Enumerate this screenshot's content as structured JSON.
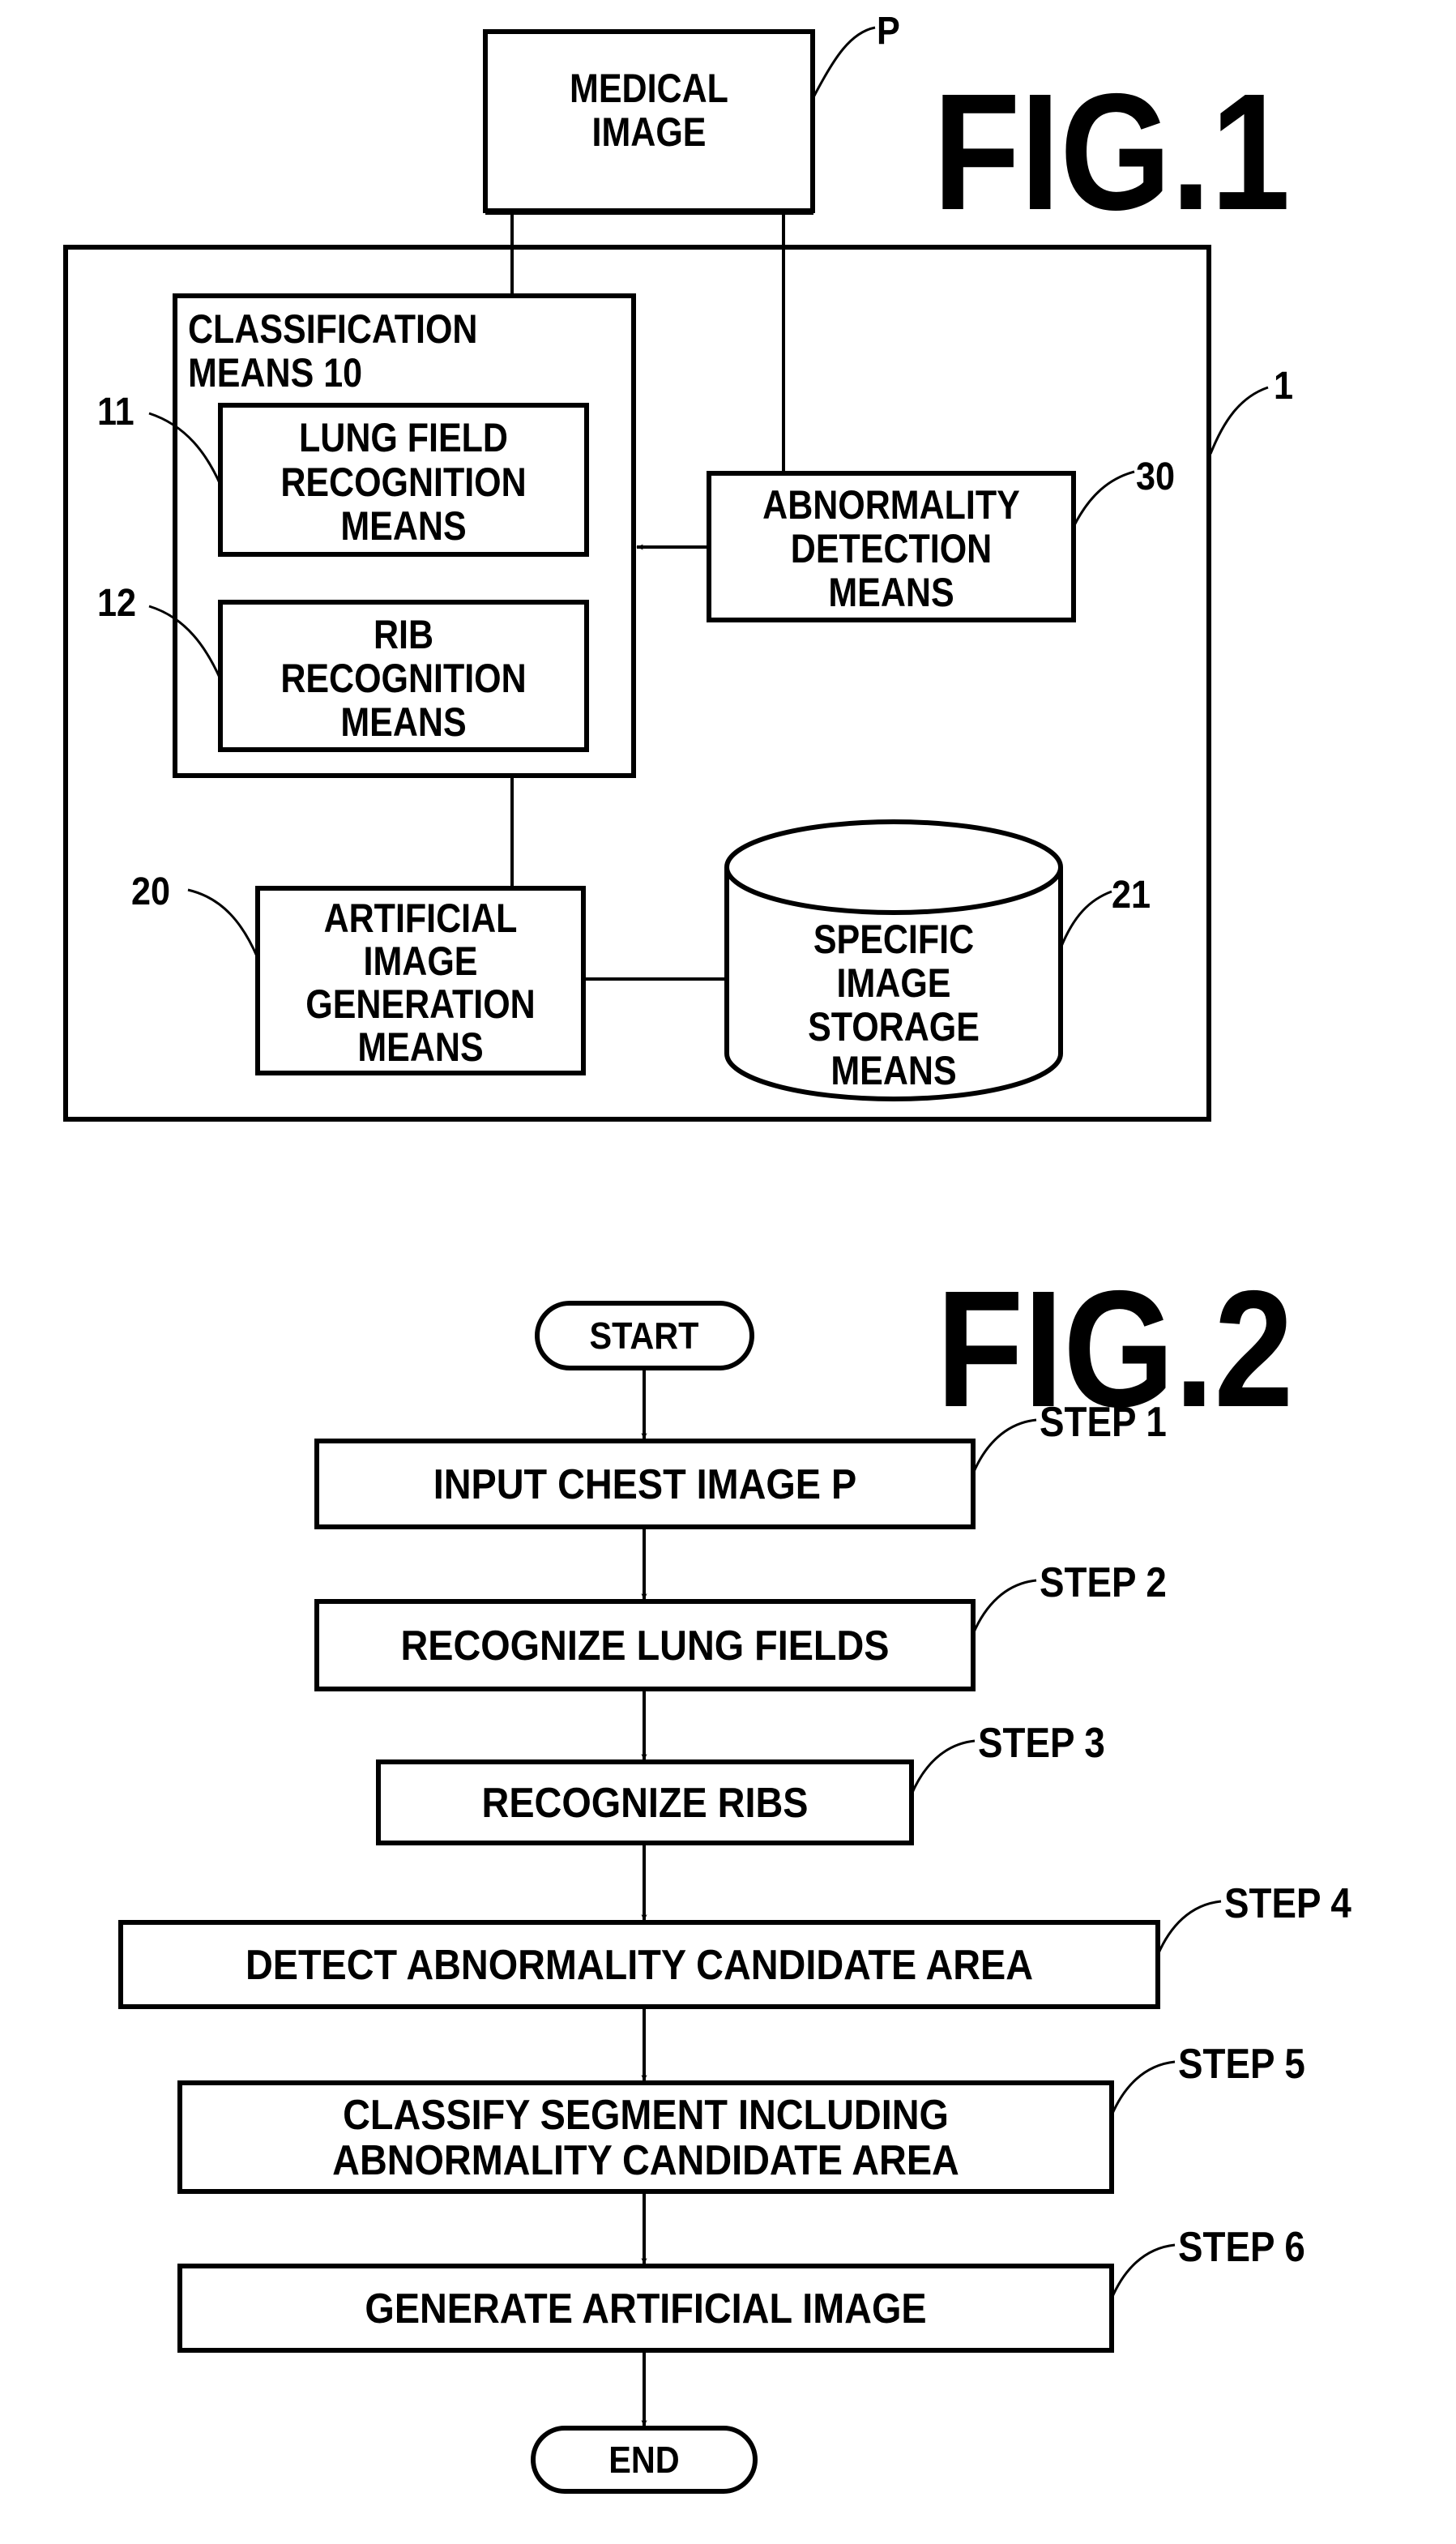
{
  "fig1": {
    "title": "FIG.1",
    "medical_image": {
      "lines": [
        "MEDICAL",
        "IMAGE"
      ],
      "ref": "P"
    },
    "apparatus": {
      "ref": "1"
    },
    "classification": {
      "lines": [
        "CLASSIFICATION",
        "MEANS 10"
      ]
    },
    "lung_field": {
      "lines": [
        "LUNG FIELD",
        "RECOGNITION",
        "MEANS"
      ],
      "ref": "11"
    },
    "rib": {
      "lines": [
        "RIB",
        "RECOGNITION",
        "MEANS"
      ],
      "ref": "12"
    },
    "abnormality": {
      "lines": [
        "ABNORMALITY",
        "DETECTION",
        "MEANS"
      ],
      "ref": "30"
    },
    "artificial": {
      "lines": [
        "ARTIFICIAL",
        "IMAGE",
        "GENERATION",
        "MEANS"
      ],
      "ref": "20"
    },
    "storage": {
      "lines": [
        "SPECIFIC",
        "IMAGE",
        "STORAGE",
        "MEANS"
      ],
      "ref": "21"
    }
  },
  "fig2": {
    "title": "FIG.2",
    "start": "START",
    "end": "END",
    "steps": [
      {
        "label": "STEP 1",
        "lines": [
          "INPUT CHEST IMAGE P"
        ]
      },
      {
        "label": "STEP 2",
        "lines": [
          "RECOGNIZE LUNG FIELDS"
        ]
      },
      {
        "label": "STEP 3",
        "lines": [
          "RECOGNIZE RIBS"
        ]
      },
      {
        "label": "STEP 4",
        "lines": [
          "DETECT ABNORMALITY CANDIDATE AREA"
        ]
      },
      {
        "label": "STEP 5",
        "lines": [
          "CLASSIFY SEGMENT INCLUDING",
          "ABNORMALITY CANDIDATE AREA"
        ]
      },
      {
        "label": "STEP 6",
        "lines": [
          "GENERATE ARTIFICIAL IMAGE"
        ]
      }
    ]
  }
}
